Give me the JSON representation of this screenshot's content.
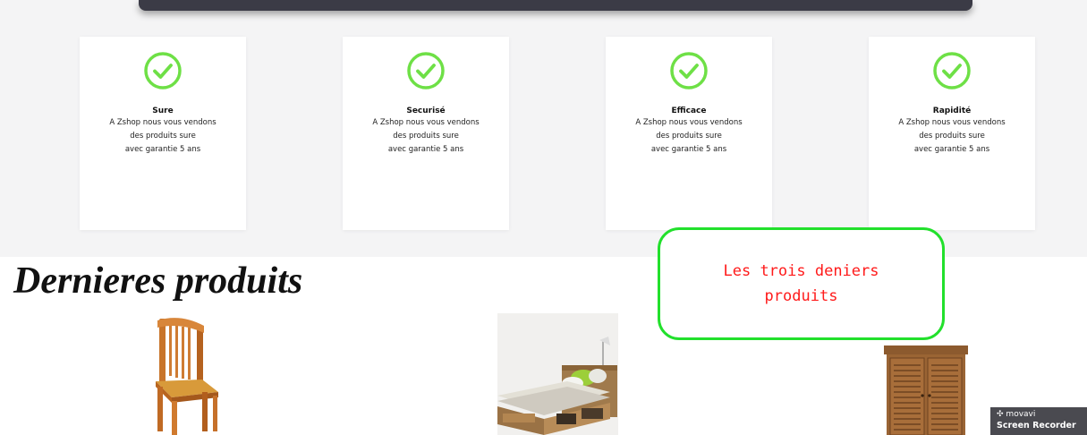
{
  "features": [
    {
      "icon": "check-circle-icon",
      "title": "Sure",
      "desc": [
        "A Zshop nous vous vendons",
        "des produits sure",
        "avec garantie 5 ans"
      ]
    },
    {
      "icon": "check-circle-icon",
      "title": "Securisé",
      "desc": [
        "A Zshop nous vous vendons",
        "des produits sure",
        "avec garantie 5 ans"
      ]
    },
    {
      "icon": "check-circle-icon",
      "title": "Efficace",
      "desc": [
        "A Zshop nous vous vendons",
        "des produits sure",
        "avec garantie 5 ans"
      ]
    },
    {
      "icon": "check-circle-icon",
      "title": "Rapidité",
      "desc": [
        "A Zshop nous vous vendons",
        "des produits sure",
        "avec garantie 5 ans"
      ]
    }
  ],
  "latest": {
    "title": "Dernieres produits",
    "products": [
      {
        "icon": "chair-image"
      },
      {
        "icon": "bed-image"
      },
      {
        "icon": "cabinet-image"
      }
    ]
  },
  "annotation": {
    "lines": [
      "Les trois deniers",
      "produits"
    ]
  },
  "watermark": {
    "brand": "movavi",
    "sub": "Screen Recorder"
  },
  "colors": {
    "check_green": "#6ee046",
    "annotation_border": "#22e02c",
    "annotation_text": "#ff1a1a",
    "band_bg": "#f4f4f5"
  }
}
